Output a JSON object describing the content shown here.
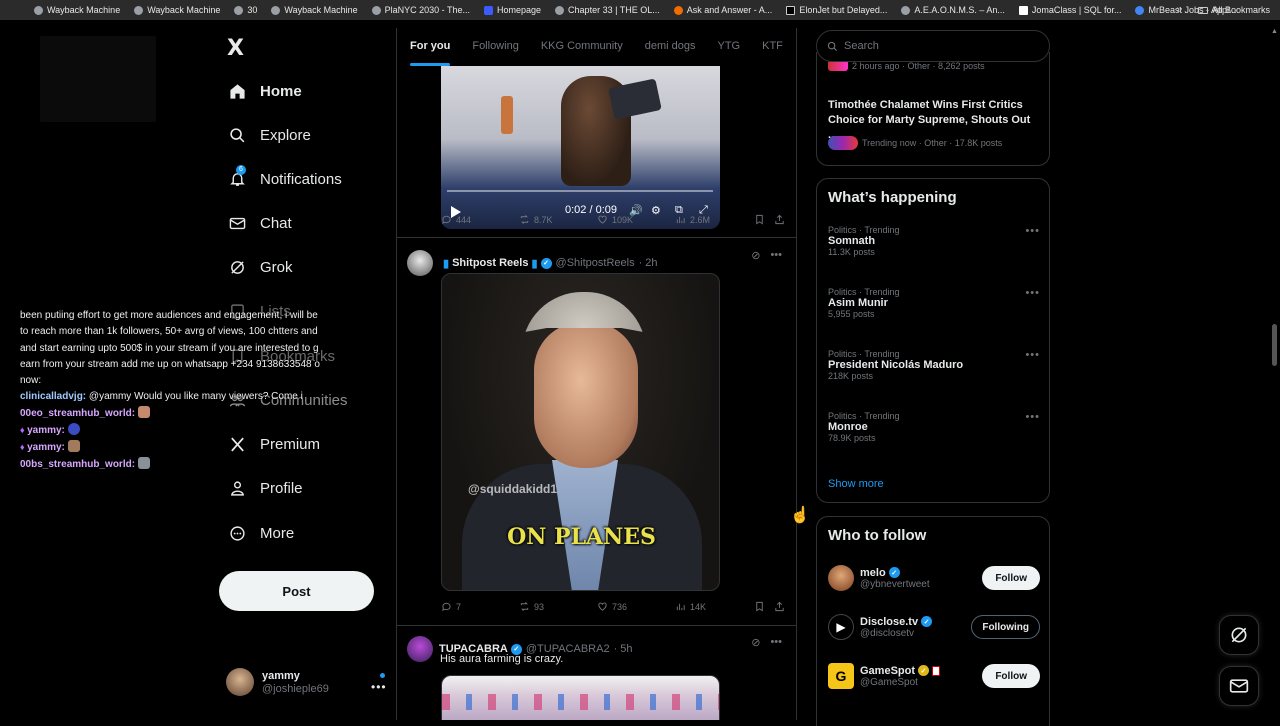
{
  "bookmarks": {
    "items": [
      "Wayback Machine",
      "Wayback Machine",
      "30",
      "Wayback Machine",
      "PlaNYC 2030 - The...",
      "Homepage",
      "Chapter 33 | THE OL...",
      "Ask and Answer - A...",
      "ElonJet but Delayed...",
      "A.E.A.O.N.M.S. – An...",
      "JomaClass | SQL for...",
      "MrBeast Jobs - Appl..."
    ],
    "all_label": "All Bookmarks"
  },
  "nav": {
    "logo": "X",
    "items": [
      {
        "label": "Home",
        "icon": "home-icon"
      },
      {
        "label": "Explore",
        "icon": "search-icon"
      },
      {
        "label": "Notifications",
        "icon": "bell-icon",
        "badge": "6"
      },
      {
        "label": "Chat",
        "icon": "mail-icon"
      },
      {
        "label": "Grok",
        "icon": "grok-icon"
      },
      {
        "label": "Lists",
        "icon": "list-icon"
      },
      {
        "label": "Bookmarks",
        "icon": "bookmark-icon"
      },
      {
        "label": "Communities",
        "icon": "communities-icon"
      },
      {
        "label": "Premium",
        "icon": "x-icon"
      },
      {
        "label": "Profile",
        "icon": "person-icon"
      },
      {
        "label": "More",
        "icon": "more-circle-icon"
      }
    ],
    "post_label": "Post",
    "account": {
      "name": "yammy",
      "handle": "@joshieple69"
    }
  },
  "chat_overlay": {
    "message_lines": [
      "been putiing effort to get more audiences and engagement, i will be",
      "to reach more than 1k followers, 50+ avrg of views, 100 chtters and",
      "and start earning upto 500$ in your stream if you are interested to g",
      "earn from your stream add me up on whatsapp +234 9138633548 o",
      "now:"
    ],
    "messages": [
      {
        "user": "clinicalladvjg:",
        "text": " @yammy Would you like many viewers? Come i",
        "color": "#9ecbff"
      },
      {
        "user": "00eo_streamhub_world:",
        "text": "",
        "color": "#d6a7ff"
      },
      {
        "user": "yammy:",
        "text": "",
        "color": "#d6a7ff"
      },
      {
        "user": "yammy:",
        "text": "",
        "color": "#d6a7ff"
      },
      {
        "user": "00bs_streamhub_world:",
        "text": "",
        "color": "#d6a7ff"
      }
    ]
  },
  "feed": {
    "tabs": [
      "For you",
      "Following",
      "KKG Community",
      "demi dogs",
      "YTG",
      "KTF"
    ],
    "video_post": {
      "time": "0:02 / 0:09",
      "stats": {
        "replies": "444",
        "reposts": "8.7K",
        "likes": "109K",
        "views": "2.6M"
      }
    },
    "post2": {
      "name": "Shitpost Reels",
      "handle": "@ShitpostReels",
      "time": "· 2h",
      "watermark": "@squiddakidd1",
      "caption": "ON PLANES",
      "stats": {
        "replies": "7",
        "reposts": "93",
        "likes": "736",
        "views": "14K"
      }
    },
    "post3": {
      "name": "TUPACABRA",
      "handle": "@TUPACABRA2",
      "time": "· 5h",
      "text": "His aura farming is crazy."
    }
  },
  "sidebar": {
    "search_placeholder": "Search",
    "top_card": {
      "meta_partial": "2 hours ago · Other · 8,262 posts",
      "title": "Timothée Chalamet Wins First Critics Choice for Marty Supreme, Shouts Out ...",
      "meta": "Trending now · Other · 17.8K posts"
    },
    "happening": {
      "title": "What’s happening",
      "trends": [
        {
          "meta": "Politics · Trending",
          "title": "Somnath",
          "posts": "11.3K posts"
        },
        {
          "meta": "Politics · Trending",
          "title": "Asim Munir",
          "posts": "5,955 posts"
        },
        {
          "meta": "Politics · Trending",
          "title": "President Nicolás Maduro",
          "posts": "218K posts"
        },
        {
          "meta": "Politics · Trending",
          "title": "Monroe",
          "posts": "78.9K posts"
        }
      ],
      "show_more": "Show more"
    },
    "who_to_follow": {
      "title": "Who to follow",
      "accounts": [
        {
          "name": "melo",
          "handle": "@ybnevertweet",
          "button": "Follow"
        },
        {
          "name": "Disclose.tv",
          "handle": "@disclosetv",
          "button": "Following"
        },
        {
          "name": "GameSpot",
          "handle": "@GameSpot",
          "button": "Follow"
        }
      ]
    }
  },
  "colors": {
    "accent": "#1d9bf0",
    "border": "#2f3336",
    "muted": "#71767b"
  }
}
